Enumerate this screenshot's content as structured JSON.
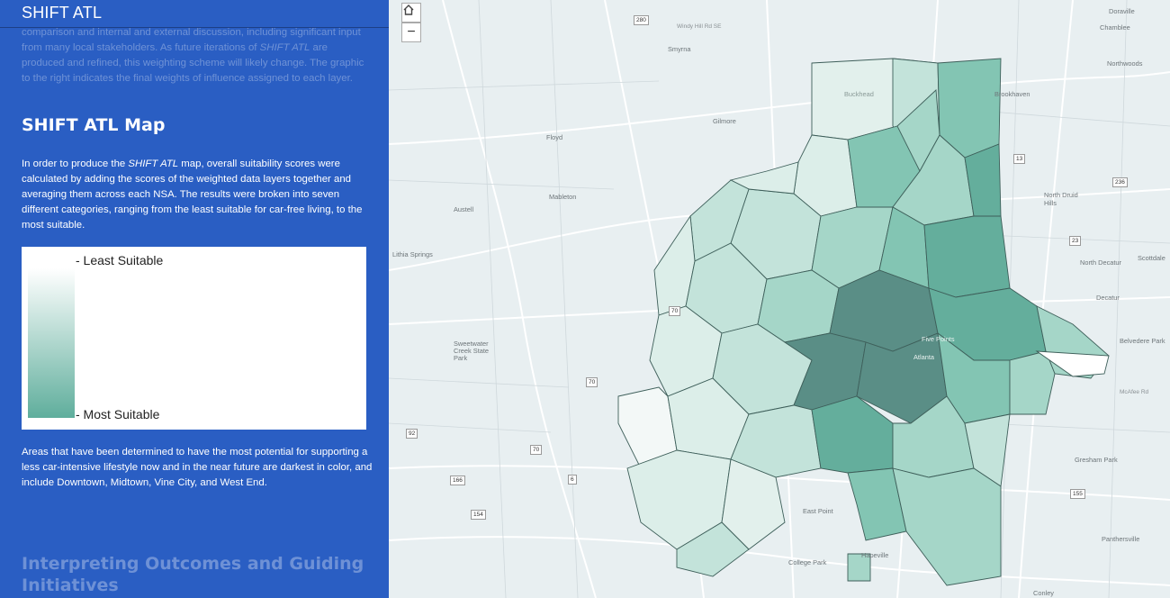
{
  "app": {
    "title": "SHIFT ATL"
  },
  "previous_section": {
    "p1": "comparison and internal and external discussion, including significant input",
    "p2a": "from many local stakeholders. As future iterations of ",
    "p2b": "SHIFT ATL",
    "p2c": " are",
    "p3": "produced and refined, this weighting scheme will likely change. The graphic",
    "p4": "to the right indicates the final weights of influence assigned to each layer."
  },
  "section": {
    "heading": "SHIFT ATL Map",
    "intro_a": "In order to produce the ",
    "intro_b": "SHIFT ATL",
    "intro_c": " map, overall suitability scores were calculated by adding the scores of the weighted data layers together and averaging them across each NSA. The results were broken into seven different categories, ranging from the least suitable for car-free living, to the most suitable.",
    "outro": "Areas that have been determined to have the most potential for supporting a less car-intensive lifestyle now and in the near future are darkest in color, and include Downtown, Midtown, Vine City, and West End."
  },
  "legend": {
    "low_label": "- Least Suitable",
    "high_label": "- Most Suitable",
    "colors": [
      "#ffffff",
      "#5fae9c"
    ]
  },
  "next_section": {
    "heading": "Interpreting Outcomes and Guiding Initiatives"
  },
  "map": {
    "home_icon": "home-icon",
    "zoom_out_label": "−",
    "places": {
      "smyrna": "Smyrna",
      "windy_hill": "Windy Hill Rd SE",
      "gilmore": "Gilmore",
      "floyd": "Floyd",
      "mableton": "Mableton",
      "austell": "Austell",
      "lithia": "Lithia Springs",
      "sweetwater": "Sweetwater Creek State Park",
      "brookhaven": "Brookhaven",
      "doraville": "Doraville",
      "chamblee": "Chamblee",
      "northwoods": "Northwoods",
      "north_druid": "North Druid Hills",
      "north_decatur": "North Decatur",
      "scottdale": "Scottdale",
      "decatur": "Decatur",
      "belvedere": "Belvedere Park",
      "mcafee": "McAfee Rd",
      "gresham": "Gresham Park",
      "panthersville": "Panthersville",
      "east_point": "East Point",
      "college_park": "College Park",
      "hapeville": "Hapeville",
      "conley": "Conley",
      "buckhead": "Buckhead",
      "atlanta": "Atlanta",
      "five_points": "Five Points"
    },
    "shields": {
      "i285a": "280",
      "i13": "13",
      "i236": "236",
      "i23": "23",
      "i70a": "70",
      "i70b": "70",
      "i70c": "70",
      "i92": "92",
      "i166": "166",
      "i154": "154",
      "i6": "6",
      "i155": "155"
    },
    "fill_colors": [
      "#f3f8f7",
      "#dceee9",
      "#c3e3da",
      "#a5d6c8",
      "#83c5b3",
      "#64ae9c",
      "#5a8e86"
    ]
  }
}
